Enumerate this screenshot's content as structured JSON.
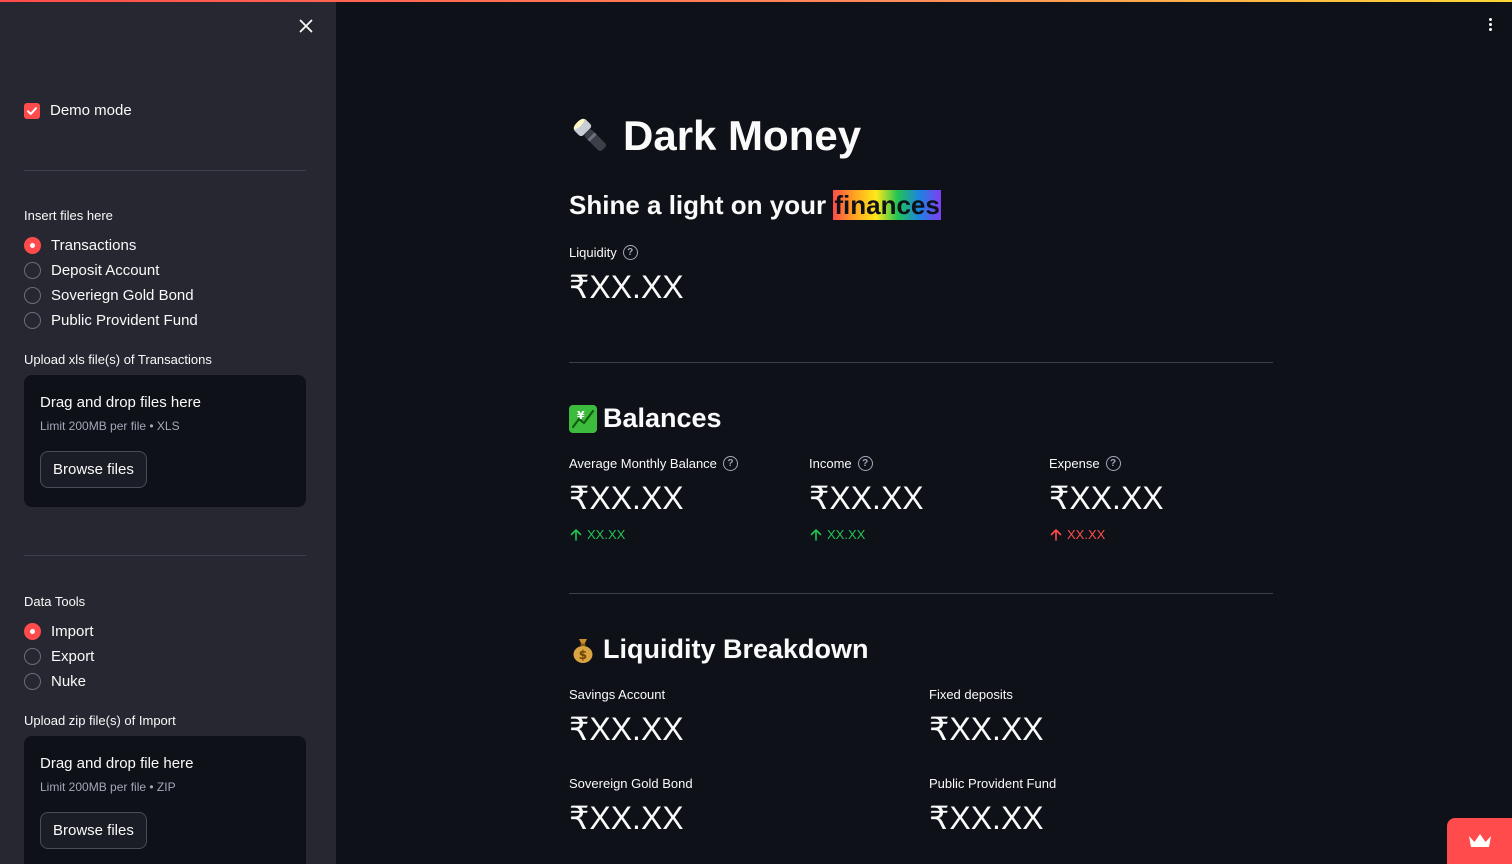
{
  "sidebar": {
    "demo_mode_label": "Demo mode",
    "insert_files_label": "Insert files here",
    "insert_options": [
      "Transactions",
      "Deposit Account",
      "Soveriegn Gold Bond",
      "Public Provident Fund"
    ],
    "insert_selected": "Transactions",
    "upload1": {
      "label": "Upload xls file(s) of Transactions",
      "title": "Drag and drop files here",
      "limit": "Limit 200MB per file • XLS",
      "button": "Browse files"
    },
    "data_tools_label": "Data Tools",
    "data_tools_options": [
      "Import",
      "Export",
      "Nuke"
    ],
    "data_tools_selected": "Import",
    "upload2": {
      "label": "Upload zip file(s) of Import",
      "title": "Drag and drop file here",
      "limit": "Limit 200MB per file • ZIP",
      "button": "Browse files"
    }
  },
  "main": {
    "title_emoji": "🔦",
    "title": "Dark Money",
    "subtitle_prefix": "Shine a light on your ",
    "subtitle_highlight": "finances",
    "liquidity": {
      "label": "Liquidity",
      "value": "₹XX.XX"
    },
    "balances": {
      "emoji": "💹",
      "title": "Balances",
      "metrics": [
        {
          "label": "Average Monthly Balance",
          "value": "₹XX.XX",
          "delta": "XX.XX",
          "delta_color": "#21c354"
        },
        {
          "label": "Income",
          "value": "₹XX.XX",
          "delta": "XX.XX",
          "delta_color": "#21c354"
        },
        {
          "label": "Expense",
          "value": "₹XX.XX",
          "delta": "XX.XX",
          "delta_color": "#ff4b4b"
        }
      ]
    },
    "breakdown": {
      "emoji": "💰",
      "title": "Liquidity Breakdown",
      "items": [
        {
          "label": "Savings Account",
          "value": "₹XX.XX"
        },
        {
          "label": "Fixed deposits",
          "value": "₹XX.XX"
        },
        {
          "label": "Sovereign Gold Bond",
          "value": "₹XX.XX"
        },
        {
          "label": "Public Provident Fund",
          "value": "₹XX.XX"
        }
      ]
    }
  },
  "colors": {
    "accent": "#ff4b4b",
    "background": "#0e1117",
    "sidebar": "#262730",
    "positive": "#21c354"
  },
  "icons": {
    "close": "close-icon",
    "menu": "kebab-menu-icon",
    "help": "help-circle-icon",
    "delta_up": "arrow-up-icon",
    "badge": "crown-icon"
  }
}
